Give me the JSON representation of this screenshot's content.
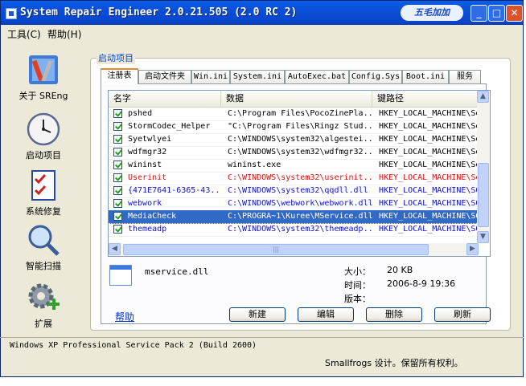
{
  "window": {
    "title": "System Repair Engineer 2.0.21.505 (2.0 RC 2)",
    "brand": "五毛加加",
    "controls": {
      "minimize": "_",
      "maximize": "□",
      "close": "✕"
    }
  },
  "menu": [
    {
      "label": "工具(C)"
    },
    {
      "label": "帮助(H)"
    }
  ],
  "nav": [
    {
      "label": "关于 SREng",
      "icon": "tools-icon"
    },
    {
      "label": "启动项目",
      "icon": "clock-icon"
    },
    {
      "label": "系统修复",
      "icon": "checklist-icon"
    },
    {
      "label": "智能扫描",
      "icon": "magnifier-icon"
    },
    {
      "label": "扩展",
      "icon": "gear-plus-icon"
    }
  ],
  "group_title": "启动项目",
  "tabs": [
    {
      "label": "注册表",
      "active": true
    },
    {
      "label": "启动文件夹"
    },
    {
      "label": "Win.ini"
    },
    {
      "label": "System.ini"
    },
    {
      "label": "AutoExec.bat"
    },
    {
      "label": "Config.Sys"
    },
    {
      "label": "Boot.ini"
    },
    {
      "label": "服务"
    }
  ],
  "columns": [
    "名字",
    "数据",
    "键路径"
  ],
  "rows": [
    {
      "name": "pshed",
      "data": "C:\\Program Files\\PocoZinePla...",
      "path": "HKEY_LOCAL_MACHINE\\Sof",
      "style": "normal"
    },
    {
      "name": "StormCodec_Helper",
      "data": "\"C:\\Program Files\\Ringz Stud...",
      "path": "HKEY_LOCAL_MACHINE\\Sof",
      "style": "normal"
    },
    {
      "name": "Syetwlyei",
      "data": "C:\\WINDOWS\\system32\\algestei...",
      "path": "HKEY_LOCAL_MACHINE\\Sof",
      "style": "normal"
    },
    {
      "name": "wdfmgr32",
      "data": "C:\\WINDOWS\\system32\\wdfmgr32...",
      "path": "HKEY_LOCAL_MACHINE\\Sof",
      "style": "normal"
    },
    {
      "name": "wininst",
      "data": "wininst.exe",
      "path": "HKEY_LOCAL_MACHINE\\Sof",
      "style": "normal"
    },
    {
      "name": "Userinit",
      "data": "C:\\WINDOWS\\system32\\userinit...",
      "path": "HKEY_LOCAL_MACHINE\\Sof",
      "style": "red"
    },
    {
      "name": "{471E7641-6365-43...",
      "data": "C:\\WINDOWS\\system32\\qqdll.dll",
      "path": "HKEY_LOCAL_MACHINE\\SOF",
      "style": "blue"
    },
    {
      "name": "webwork",
      "data": "C:\\WINDOWS\\webwork\\webwork.dll",
      "path": "HKEY_LOCAL_MACHINE\\SOF",
      "style": "blue"
    },
    {
      "name": "MediaCheck",
      "data": "C:\\PROGRA~1\\Kuree\\MService.dll",
      "path": "HKEY_LOCAL_MACHINE\\SOF",
      "style": "selected"
    },
    {
      "name": "themeadp",
      "data": "C:\\WINDOWS\\system32\\themeadp...",
      "path": "HKEY_LOCAL_MACHINE\\SOF",
      "style": "blue"
    }
  ],
  "details": {
    "filename": "mservice.dll",
    "size_label": "大小：",
    "size_value": "20 KB",
    "time_label": "时间：",
    "time_value": "2006-8-9 19:36",
    "version_label": "版本："
  },
  "help_link": "帮助",
  "buttons": {
    "new": "新建",
    "edit": "编辑",
    "delete": "删除",
    "refresh": "刷新"
  },
  "status": {
    "os": "Windows XP Professional Service Pack 2 (Build 2600)",
    "credit": "Smallfrogs 设计。保留所有权利。"
  },
  "colors": {
    "title_bar": "#0B4ED8",
    "selection": "#316AC5",
    "danger": "#E01010",
    "suspect": "#1010D0"
  }
}
